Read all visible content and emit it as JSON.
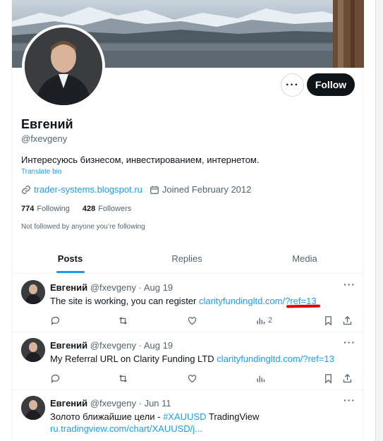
{
  "colors": {
    "accent": "#1d9bf0",
    "text": "#0f1419",
    "muted": "#536471",
    "annotation": "#e00000"
  },
  "header": {
    "more_icon": "more-horizontal-icon",
    "follow_label": "Follow"
  },
  "profile": {
    "display_name": "Евгений",
    "handle": "@fxevgeny",
    "bio": "Интересуюсь бизнесом, инвестированием, интернетом.",
    "translate_label": "Translate bio",
    "website": "trader-systems.blogspot.ru",
    "joined": "Joined February 2012",
    "following_count": "774",
    "following_label": "Following",
    "followers_count": "428",
    "followers_label": "Followers",
    "not_followed_note": "Not followed by anyone you’re following"
  },
  "tabs": [
    {
      "label": "Posts",
      "active": true
    },
    {
      "label": "Replies",
      "active": false
    },
    {
      "label": "Media",
      "active": false
    }
  ],
  "tweets": [
    {
      "name": "Евгений",
      "handle_date": "@fxevgeny · Aug 19",
      "text": "The site is working, you can register ",
      "link": "clarityfundingltd.com/?ref=13",
      "text2": "",
      "link2": "",
      "views": "2"
    },
    {
      "name": "Евгений",
      "handle_date": "@fxevgeny · Aug 19",
      "text": "My Referral URL on Clarity Funding LTD ",
      "link": "clarityfundingltd.com/?ref=13",
      "text2": "",
      "link2": "",
      "views": ""
    },
    {
      "name": "Евгений",
      "handle_date": "@fxevgeny · Jun 11",
      "text": "Золото ближайшие цели - ",
      "link": "#XAUUSD",
      "text2": " TradingView",
      "link2": "ru.tradingview.com/chart/XAUUSD/j...",
      "views": ""
    }
  ]
}
